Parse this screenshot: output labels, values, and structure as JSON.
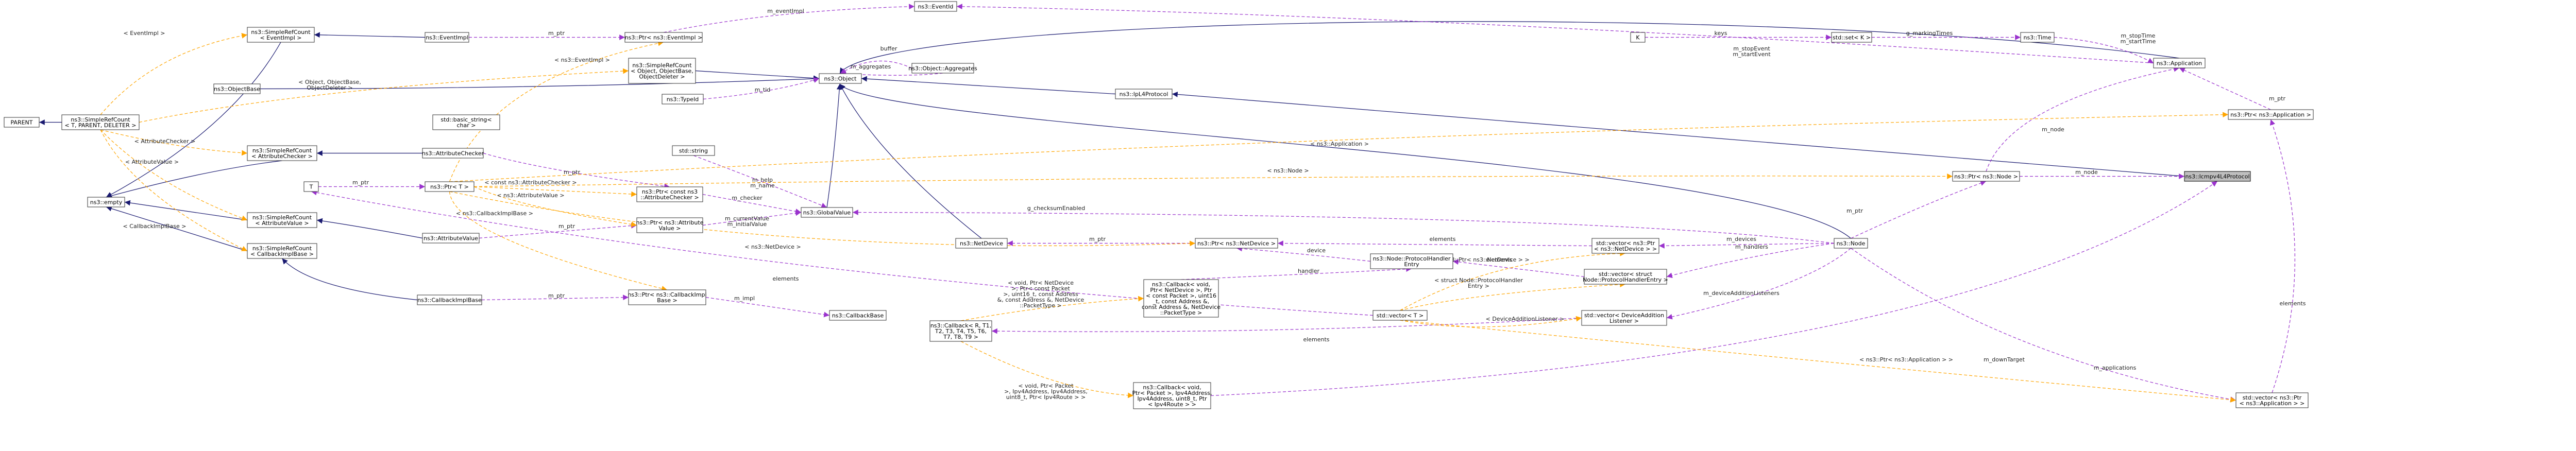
{
  "diagram": {
    "title": "",
    "nodes": [
      {
        "id": "target",
        "lines": [
          "ns3::Icmpv4L4Protocol"
        ],
        "highlight": true
      },
      {
        "id": "ipl4",
        "lines": [
          "ns3::IpL4Protocol"
        ]
      },
      {
        "id": "object",
        "lines": [
          "ns3::Object"
        ]
      },
      {
        "id": "objbase",
        "lines": [
          "ns3::ObjectBase"
        ]
      },
      {
        "id": "srcObj",
        "lines": [
          "ns3::SimpleRefCount",
          "< Object, ObjectBase,",
          "ObjectDeleter >"
        ]
      },
      {
        "id": "typeid",
        "lines": [
          "ns3::TypeId"
        ]
      },
      {
        "id": "aggr",
        "lines": [
          "ns3::Object::Aggregates"
        ]
      },
      {
        "id": "eventid",
        "lines": [
          "ns3::EventId"
        ]
      },
      {
        "id": "ptrEventImpl",
        "lines": [
          "ns3::Ptr< ns3::EventImpl >"
        ]
      },
      {
        "id": "eventimpl",
        "lines": [
          "ns3::EventImpl"
        ]
      },
      {
        "id": "srcEventImpl",
        "lines": [
          "ns3::SimpleRefCount",
          "< EventImpl >"
        ]
      },
      {
        "id": "srcGeneric",
        "lines": [
          "ns3::SimpleRefCount",
          "< T, PARENT, DELETER >"
        ]
      },
      {
        "id": "parent",
        "lines": [
          "PARENT"
        ]
      },
      {
        "id": "empty",
        "lines": [
          "ns3::empty"
        ]
      },
      {
        "id": "stdbasic",
        "lines": [
          "std::basic_string<",
          "char >"
        ]
      },
      {
        "id": "stdstring",
        "lines": [
          "std::string"
        ]
      },
      {
        "id": "srcAttrChecker",
        "lines": [
          "ns3::SimpleRefCount",
          "< AttributeChecker >"
        ]
      },
      {
        "id": "attrChecker",
        "lines": [
          "ns3::AttributeChecker"
        ]
      },
      {
        "id": "T",
        "lines": [
          "T"
        ]
      },
      {
        "id": "ptrT",
        "lines": [
          "ns3::Ptr< T >"
        ]
      },
      {
        "id": "ptrConstChecker",
        "lines": [
          "ns3::Ptr< const ns3",
          "::AttributeChecker >"
        ]
      },
      {
        "id": "ptrAttrValue",
        "lines": [
          "ns3::Ptr< ns3::Attribute",
          "Value >"
        ]
      },
      {
        "id": "globalvalue",
        "lines": [
          "ns3::GlobalValue"
        ]
      },
      {
        "id": "srcAttrValue",
        "lines": [
          "ns3::SimpleRefCount",
          "< AttributeValue >"
        ]
      },
      {
        "id": "attrValue",
        "lines": [
          "ns3::AttributeValue"
        ]
      },
      {
        "id": "srcCbImpl",
        "lines": [
          "ns3::SimpleRefCount",
          "< CallbackImplBase >"
        ]
      },
      {
        "id": "cbImplBase",
        "lines": [
          "ns3::CallbackImplBase"
        ]
      },
      {
        "id": "ptrCbImpl",
        "lines": [
          "ns3::Ptr< ns3::CallbackImpl",
          "Base >"
        ]
      },
      {
        "id": "cbBase",
        "lines": [
          "ns3::CallbackBase"
        ]
      },
      {
        "id": "netdevice",
        "lines": [
          "ns3::NetDevice"
        ]
      },
      {
        "id": "ptrNetDevice",
        "lines": [
          "ns3::Ptr< ns3::NetDevice >"
        ]
      },
      {
        "id": "protoHandlerEntry",
        "lines": [
          "ns3::Node::ProtocolHandler",
          "Entry"
        ]
      },
      {
        "id": "cbVoid1",
        "lines": [
          "ns3::Callback< void,",
          "Ptr< NetDevice >, Ptr",
          "< const Packet >, uint16",
          "_t, const Address &,",
          "const Address &, NetDevice",
          "::PacketType >"
        ]
      },
      {
        "id": "cbGeneric",
        "lines": [
          "ns3::Callback< R, T1,",
          "T2, T3, T4, T5, T6,",
          "T7, T8, T9 >"
        ]
      },
      {
        "id": "cbVoid2",
        "lines": [
          "ns3::Callback< void,",
          "Ptr< Packet >, Ipv4Address,",
          "Ipv4Address, uint8_t, Ptr",
          "< Ipv4Route > >"
        ]
      },
      {
        "id": "stdvectorT",
        "lines": [
          "std::vector< T >"
        ]
      },
      {
        "id": "vecNetDevice",
        "lines": [
          "std::vector< ns3::Ptr",
          "< ns3::NetDevice > >"
        ]
      },
      {
        "id": "vecProtoHandler",
        "lines": [
          "std::vector< struct",
          "Node::ProtocolHandlerEntry >"
        ]
      },
      {
        "id": "vecDevAddListener",
        "lines": [
          "std::vector< DeviceAddition",
          "Listener >"
        ]
      },
      {
        "id": "node",
        "lines": [
          "ns3::Node"
        ]
      },
      {
        "id": "ptrNode",
        "lines": [
          "ns3::Ptr< ns3::Node >"
        ]
      },
      {
        "id": "application",
        "lines": [
          "ns3::Application"
        ]
      },
      {
        "id": "time",
        "lines": [
          "ns3::Time"
        ]
      },
      {
        "id": "stdsetK",
        "lines": [
          "std::set< K >"
        ]
      },
      {
        "id": "K",
        "lines": [
          "K"
        ]
      },
      {
        "id": "ptrApplication",
        "lines": [
          "ns3::Ptr< ns3::Application >"
        ]
      },
      {
        "id": "vecApplication",
        "lines": [
          "std::vector< ns3::Ptr",
          "< ns3::Application > >"
        ]
      }
    ],
    "edges": [
      {
        "id": "e1",
        "kind": "inherit",
        "label": []
      },
      {
        "id": "e2",
        "kind": "inherit",
        "label": []
      },
      {
        "id": "e3",
        "kind": "inherit",
        "label": []
      },
      {
        "id": "e4",
        "kind": "inherit",
        "label": []
      },
      {
        "id": "e5",
        "kind": "inherit",
        "label": []
      },
      {
        "id": "e6",
        "kind": "inherit",
        "label": []
      },
      {
        "id": "e7",
        "kind": "inherit",
        "label": []
      },
      {
        "id": "e8",
        "kind": "inherit",
        "label": []
      },
      {
        "id": "e9",
        "kind": "inherit",
        "label": []
      },
      {
        "id": "e10",
        "kind": "inherit",
        "label": []
      },
      {
        "id": "e11",
        "kind": "inherit",
        "label": []
      },
      {
        "id": "e12",
        "kind": "inherit",
        "label": []
      },
      {
        "id": "e13",
        "kind": "inherit",
        "label": []
      },
      {
        "id": "e14",
        "kind": "inherit",
        "label": []
      },
      {
        "id": "e15",
        "kind": "inherit",
        "label": []
      },
      {
        "id": "e16",
        "kind": "inherit",
        "label": []
      },
      {
        "id": "e17",
        "kind": "inherit",
        "label": []
      },
      {
        "id": "u1",
        "kind": "usage",
        "label": [
          "m_node"
        ]
      },
      {
        "id": "u2",
        "kind": "usage",
        "label": [
          "m_downTarget"
        ]
      },
      {
        "id": "u3",
        "kind": "usage",
        "label": [
          "m_ptr"
        ]
      },
      {
        "id": "u4",
        "kind": "usage",
        "label": [
          "m_node"
        ]
      },
      {
        "id": "u5",
        "kind": "usage",
        "label": [
          "m_stopTime",
          "m_startTime"
        ]
      },
      {
        "id": "u6",
        "kind": "usage",
        "label": [
          "g_markingTimes"
        ]
      },
      {
        "id": "u7",
        "kind": "usage",
        "label": [
          "keys"
        ]
      },
      {
        "id": "u8",
        "kind": "usage",
        "label": [
          "m_stopEvent",
          "m_startEvent"
        ]
      },
      {
        "id": "u9",
        "kind": "usage",
        "label": [
          "m_eventImpl"
        ]
      },
      {
        "id": "u10",
        "kind": "usage",
        "label": [
          "m_ptr"
        ]
      },
      {
        "id": "u11",
        "kind": "usage",
        "label": [
          "buffer"
        ]
      },
      {
        "id": "u12",
        "kind": "usage",
        "label": [
          "m_aggregates"
        ]
      },
      {
        "id": "u13",
        "kind": "usage",
        "label": [
          "m_tid"
        ]
      },
      {
        "id": "u14",
        "kind": "usage",
        "label": [
          "m_ptr"
        ]
      },
      {
        "id": "u15",
        "kind": "usage",
        "label": [
          "elements"
        ]
      },
      {
        "id": "u16",
        "kind": "usage",
        "label": [
          "m_applications"
        ]
      },
      {
        "id": "u17",
        "kind": "usage",
        "label": [
          "m_devices"
        ]
      },
      {
        "id": "u18",
        "kind": "usage",
        "label": [
          "elements"
        ]
      },
      {
        "id": "u19",
        "kind": "usage",
        "label": [
          "m_ptr"
        ]
      },
      {
        "id": "u20",
        "kind": "usage",
        "label": [
          "device"
        ]
      },
      {
        "id": "u21",
        "kind": "usage",
        "label": [
          "m_handlers"
        ]
      },
      {
        "id": "u22",
        "kind": "usage",
        "label": [
          "elements"
        ]
      },
      {
        "id": "u23",
        "kind": "usage",
        "label": [
          "handler"
        ]
      },
      {
        "id": "u24",
        "kind": "usage",
        "label": [
          "m_deviceAdditionListeners"
        ]
      },
      {
        "id": "u25",
        "kind": "usage",
        "label": [
          "elements"
        ]
      },
      {
        "id": "u26",
        "kind": "usage",
        "label": [
          "g_checksumEnabled"
        ]
      },
      {
        "id": "u27",
        "kind": "usage",
        "label": [
          "m_help",
          "m_name"
        ]
      },
      {
        "id": "u28",
        "kind": "usage",
        "label": [
          "m_checker"
        ]
      },
      {
        "id": "u29",
        "kind": "usage",
        "label": [
          "m_currentValue",
          "m_initialValue"
        ]
      },
      {
        "id": "u30",
        "kind": "usage",
        "label": [
          "m_ptr"
        ]
      },
      {
        "id": "u31",
        "kind": "usage",
        "label": [
          "m_ptr"
        ]
      },
      {
        "id": "u32",
        "kind": "usage",
        "label": [
          "m_ptr"
        ]
      },
      {
        "id": "u33",
        "kind": "usage",
        "label": [
          "m_impl"
        ]
      },
      {
        "id": "u34",
        "kind": "usage",
        "label": [
          "m_ptr"
        ]
      },
      {
        "id": "u35",
        "kind": "usage",
        "label": [
          "elements"
        ]
      },
      {
        "id": "t1",
        "kind": "template",
        "label": [
          "< EventImpl >"
        ]
      },
      {
        "id": "t2",
        "kind": "template",
        "label": [
          "< Object, ObjectBase,",
          "ObjectDeleter >"
        ]
      },
      {
        "id": "t3",
        "kind": "template",
        "label": [
          "< AttributeChecker >"
        ]
      },
      {
        "id": "t4",
        "kind": "template",
        "label": [
          "< AttributeValue >"
        ]
      },
      {
        "id": "t5",
        "kind": "template",
        "label": [
          "< CallbackImplBase >"
        ]
      },
      {
        "id": "t6",
        "kind": "template",
        "label": [
          "< ns3::EventImpl >"
        ]
      },
      {
        "id": "t7",
        "kind": "template",
        "label": [
          "< const ns3::AttributeChecker >"
        ]
      },
      {
        "id": "t8",
        "kind": "template",
        "label": [
          "< ns3::AttributeValue >"
        ]
      },
      {
        "id": "t9",
        "kind": "template",
        "label": [
          "< ns3::CallbackImplBase >"
        ]
      },
      {
        "id": "t10",
        "kind": "template",
        "label": [
          "< ns3::NetDevice >"
        ]
      },
      {
        "id": "t11",
        "kind": "template",
        "label": [
          "< ns3::Node >"
        ]
      },
      {
        "id": "t12",
        "kind": "template",
        "label": [
          "< ns3::Application >"
        ]
      },
      {
        "id": "t13",
        "kind": "template",
        "label": [
          "< ns3::Ptr< ns3::NetDevice > >"
        ]
      },
      {
        "id": "t14",
        "kind": "template",
        "label": [
          "< struct Node::ProtocolHandler",
          "Entry >"
        ]
      },
      {
        "id": "t15",
        "kind": "template",
        "label": [
          "< DeviceAdditionListener >"
        ]
      },
      {
        "id": "t16",
        "kind": "template",
        "label": [
          "< ns3::Ptr< ns3::Application > >"
        ]
      },
      {
        "id": "t17",
        "kind": "template",
        "label": [
          "< void, Ptr< NetDevice",
          ">, Ptr< const Packet",
          ">, uint16_t, const Address",
          "&, const Address &, NetDevice",
          "::PacketType >"
        ]
      },
      {
        "id": "t18",
        "kind": "template",
        "label": [
          "< void, Ptr< Packet",
          ">, Ipv4Address, Ipv4Address,",
          "uint8_t, Ptr< Ipv4Route > >"
        ]
      }
    ],
    "colors": {
      "inherit_edge": "#191970",
      "usage_edge": "#9a32cd",
      "template_edge": "#ffa500",
      "highlight_fill": "#bfbfbf",
      "node_border": "#333333"
    }
  }
}
